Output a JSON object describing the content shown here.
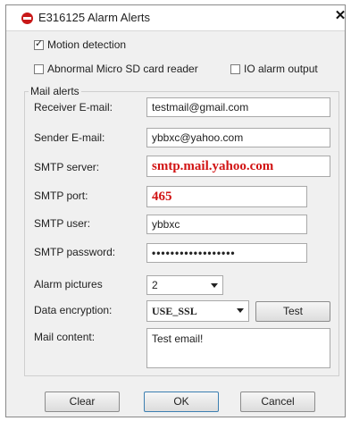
{
  "window": {
    "title": "E316125 Alarm Alerts",
    "close_label": "✕"
  },
  "options": {
    "motion_detection": {
      "label": "Motion detection",
      "checked": true
    },
    "sd_card_reader": {
      "label": "Abnormal Micro SD card reader",
      "checked": false
    },
    "io_alarm_output": {
      "label": "IO alarm output",
      "checked": false
    }
  },
  "mail_alerts": {
    "group_label": "Mail alerts",
    "receiver": {
      "label": "Receiver E-mail:",
      "value": "testmail@gmail.com"
    },
    "sender": {
      "label": "Sender E-mail:",
      "value": "ybbxc@yahoo.com"
    },
    "smtp_server": {
      "label": "SMTP server:",
      "value": "smtp.mail.yahoo.com"
    },
    "smtp_port": {
      "label": "SMTP port:",
      "value": "465"
    },
    "smtp_user": {
      "label": "SMTP user:",
      "value": "ybbxc"
    },
    "smtp_password": {
      "label": "SMTP password:",
      "value": "••••••••••••••••••"
    },
    "alarm_pictures": {
      "label": "Alarm pictures",
      "value": "2"
    },
    "data_encryption": {
      "label": "Data encryption:",
      "value": "USE_SSL"
    },
    "test_label": "Test",
    "mail_content": {
      "label": "Mail content:",
      "value": "Test email!"
    }
  },
  "footer": {
    "clear_label": "Clear",
    "ok_label": "OK",
    "cancel_label": "Cancel"
  },
  "colors": {
    "highlight_red": "#d11414",
    "ok_border": "#3c7fb1"
  }
}
